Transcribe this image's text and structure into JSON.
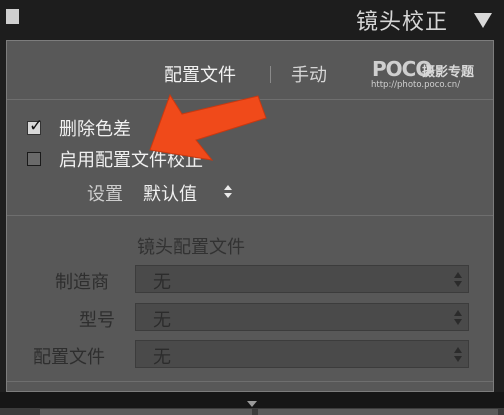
{
  "header": {
    "title": "镜头校正"
  },
  "tabs": [
    {
      "label": "配置文件",
      "active": true
    },
    {
      "label": "手动",
      "active": false
    }
  ],
  "watermark": {
    "logo": "POCO",
    "brand": "摄影专题",
    "url": "http://photo.poco.cn/"
  },
  "options": {
    "remove_ca": {
      "label": "删除色差",
      "checked": true
    },
    "enable_profile": {
      "label": "启用配置文件校正",
      "checked": false
    }
  },
  "setup": {
    "label": "设置",
    "value": "默认值"
  },
  "lens_profile": {
    "title": "镜头配置文件",
    "fields": [
      {
        "label": "制造商",
        "value": "无"
      },
      {
        "label": "型号",
        "value": "无"
      },
      {
        "label": "配置文件",
        "value": "无"
      }
    ]
  },
  "colors": {
    "annotation_arrow": "#f04a1a",
    "panel_bg": "#585858"
  }
}
